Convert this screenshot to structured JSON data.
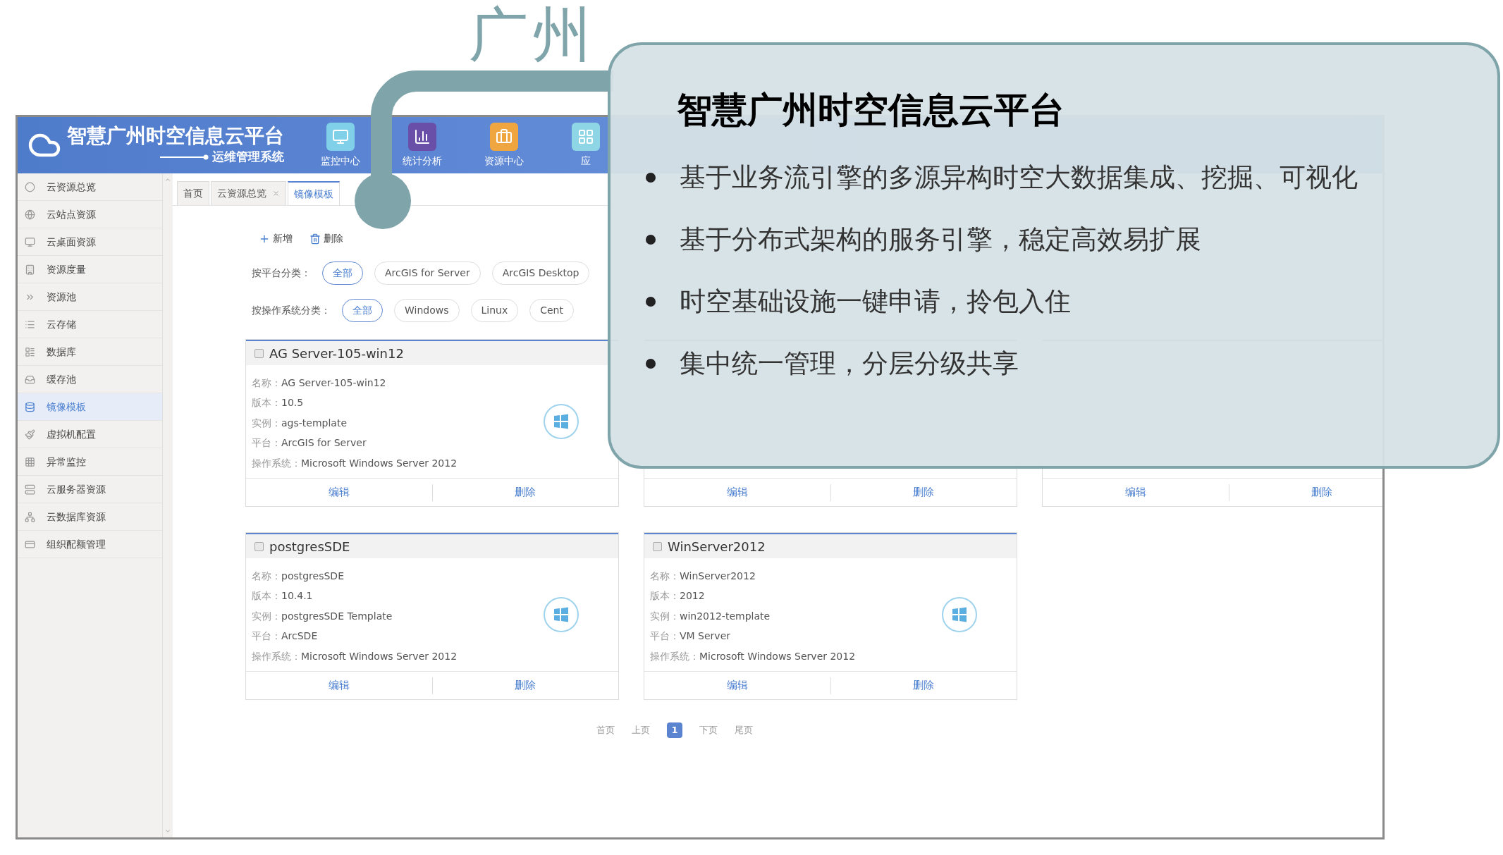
{
  "slide_title": "广州",
  "app": {
    "logo_title": "智慧广州时空信息云平台",
    "logo_subtitle": "运维管理系统",
    "nav": [
      {
        "label": "监控中心",
        "color": "#7fd0e8",
        "kind": "monitor"
      },
      {
        "label": "统计分析",
        "color": "#6a4fa8",
        "kind": "chart"
      },
      {
        "label": "资源中心",
        "color": "#f0a640",
        "kind": "case"
      },
      {
        "label": "应",
        "color": "#8ed6e6",
        "kind": "grid"
      }
    ],
    "sidebar": [
      {
        "label": "云资源总览",
        "selected": false
      },
      {
        "label": "云站点资源",
        "selected": false
      },
      {
        "label": "云桌面资源",
        "selected": false
      },
      {
        "label": "资源度量",
        "selected": false
      },
      {
        "label": "资源池",
        "selected": false
      },
      {
        "label": "云存储",
        "selected": false
      },
      {
        "label": "数据库",
        "selected": false
      },
      {
        "label": "缓存池",
        "selected": false
      },
      {
        "label": "镜像模板",
        "selected": true
      },
      {
        "label": "虚拟机配置",
        "selected": false
      },
      {
        "label": "异常监控",
        "selected": false
      },
      {
        "label": "云服务器资源",
        "selected": false
      },
      {
        "label": "云数据库资源",
        "selected": false
      },
      {
        "label": "组织配额管理",
        "selected": false
      }
    ],
    "tabs": [
      {
        "label": "首页",
        "selected": false,
        "closable": false
      },
      {
        "label": "云资源总览",
        "selected": false,
        "closable": true
      },
      {
        "label": "镜像模板",
        "selected": true,
        "closable": false
      }
    ],
    "toolbar": [
      {
        "label": "新增",
        "kind": "add"
      },
      {
        "label": "删除",
        "kind": "delete"
      }
    ],
    "filters": [
      {
        "label": "按平台分类：",
        "options": [
          {
            "label": "全部",
            "selected": true
          },
          {
            "label": "ArcGIS for Server",
            "selected": false
          },
          {
            "label": "ArcGIS Desktop",
            "selected": false
          }
        ]
      },
      {
        "label": "按操作系统分类：",
        "options": [
          {
            "label": "全部",
            "selected": true
          },
          {
            "label": "Windows",
            "selected": false
          },
          {
            "label": "Linux",
            "selected": false
          },
          {
            "label": "Cent",
            "selected": false
          }
        ]
      }
    ],
    "cards": [
      {
        "title": "AG Server-105-win12",
        "checked": false,
        "fields": [
          {
            "label": "名称：",
            "value": "AG Server-105-win12"
          },
          {
            "label": "版本：",
            "value": "10.5"
          },
          {
            "label": "实例：",
            "value": "ags-template"
          },
          {
            "label": "平台：",
            "value": "ArcGIS for Server"
          },
          {
            "label": "操作系统：",
            "value": "Microsoft Windows Server 2012"
          }
        ],
        "actions": [
          "编辑",
          "删除"
        ]
      },
      {
        "actions": [
          "编辑",
          "删除"
        ]
      },
      {
        "actions": [
          "编辑",
          "删除"
        ]
      },
      {
        "title": "postgresSDE",
        "checked": false,
        "fields": [
          {
            "label": "名称：",
            "value": "postgresSDE"
          },
          {
            "label": "版本：",
            "value": "10.4.1"
          },
          {
            "label": "实例：",
            "value": "postgresSDE Template"
          },
          {
            "label": "平台：",
            "value": "ArcSDE"
          },
          {
            "label": "操作系统：",
            "value": "Microsoft Windows Server 2012"
          }
        ],
        "actions": [
          "编辑",
          "删除"
        ]
      },
      {
        "title": "WinServer2012",
        "checked": false,
        "fields": [
          {
            "label": "名称：",
            "value": "WinServer2012"
          },
          {
            "label": "版本：",
            "value": "2012"
          },
          {
            "label": "实例：",
            "value": "win2012-template"
          },
          {
            "label": "平台：",
            "value": "VM Server"
          },
          {
            "label": "操作系统：",
            "value": "Microsoft Windows Server 2012"
          }
        ],
        "actions": [
          "编辑",
          "删除"
        ]
      }
    ],
    "pagination": {
      "first": "首页",
      "prev": "上页",
      "pages": [
        {
          "label": "1",
          "selected": true
        }
      ],
      "next": "下页",
      "last": "尾页"
    }
  },
  "callout": {
    "title": "智慧广州时空信息云平台",
    "bullets": [
      "基于业务流引擎的多源异构时空大数据集成、挖掘、可视化",
      "基于分布式架构的服务引擎，稳定高效易扩展",
      "时空基础设施一键申请，拎包入住",
      "集中统一管理，分层分级共享"
    ]
  }
}
